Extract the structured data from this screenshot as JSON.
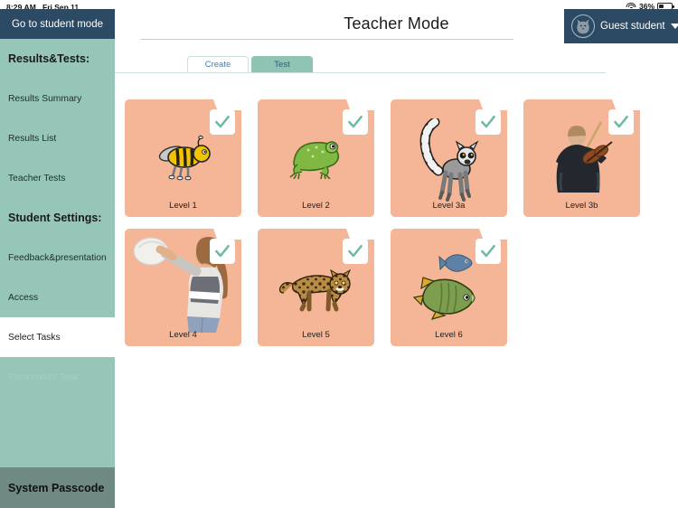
{
  "statusbar": {
    "time": "8:29 AM",
    "date": "Fri Sep 11",
    "wifi_icon": "wifi-icon",
    "battery_percent": "36%",
    "battery_icon": "battery-icon"
  },
  "sidebar": {
    "student_mode_button": "Go to student mode",
    "items": [
      {
        "label": "Results&Tests:",
        "type": "section"
      },
      {
        "label": "Results Summary",
        "type": "item"
      },
      {
        "label": "Results List",
        "type": "item"
      },
      {
        "label": "Teacher Tests",
        "type": "item"
      },
      {
        "label": "Student Settings:",
        "type": "section"
      },
      {
        "label": "Feedback&presentation",
        "type": "item"
      },
      {
        "label": "Access",
        "type": "item"
      },
      {
        "label": "Select Tasks",
        "type": "item",
        "state": "selected"
      },
      {
        "label": "Personalize Task",
        "type": "item",
        "state": "disabled"
      }
    ],
    "passcode": "System Passcode"
  },
  "header": {
    "title": "Teacher Mode",
    "guest_button": "Guest student",
    "avatar_icon": "cat-avatar-icon",
    "caret_icon": "chevron-down-icon"
  },
  "tabs": [
    {
      "label": "Create",
      "active": false
    },
    {
      "label": "Test",
      "active": true
    }
  ],
  "cards": [
    {
      "label": "Level 1",
      "art": "bee-icon",
      "checked": true
    },
    {
      "label": "Level 2",
      "art": "frog-icon",
      "checked": true
    },
    {
      "label": "Level 3a",
      "art": "lemur-icon",
      "checked": true
    },
    {
      "label": "Level 3b",
      "art": "violinist-icon",
      "checked": true
    },
    {
      "label": "Level 4",
      "art": "ballthrow-icon",
      "checked": true
    },
    {
      "label": "Level 5",
      "art": "leopard-icon",
      "checked": true
    },
    {
      "label": "Level 6",
      "art": "fish-icon",
      "checked": true
    }
  ],
  "colors": {
    "sidebar": "#95C6B7",
    "navy": "#2C4A63",
    "card": "#F4B696",
    "passcode_bar": "#6E8A82",
    "check": "#6FB9A3",
    "tab_active": "#8FC3B4"
  }
}
